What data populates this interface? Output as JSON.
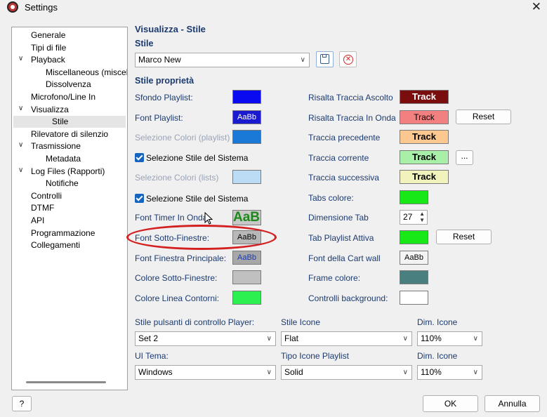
{
  "window": {
    "title": "Settings",
    "close": "✕"
  },
  "tree": {
    "items": [
      {
        "label": "Generale"
      },
      {
        "label": "Tipi di file"
      },
      {
        "label": "Playback",
        "expanded": true
      },
      {
        "label": "Miscellaneous (miscela"
      },
      {
        "label": "Dissolvenza"
      },
      {
        "label": "Microfono/Line In"
      },
      {
        "label": "Visualizza",
        "expanded": true
      },
      {
        "label": "Stile",
        "selected": true
      },
      {
        "label": "Rilevatore di silenzio"
      },
      {
        "label": "Trasmissione",
        "expanded": true
      },
      {
        "label": "Metadata"
      },
      {
        "label": "Log Files (Rapporti)",
        "expanded": true
      },
      {
        "label": "Notifiche"
      },
      {
        "label": "Controlli"
      },
      {
        "label": "DTMF"
      },
      {
        "label": "API"
      },
      {
        "label": "Programmazione"
      },
      {
        "label": "Collegamenti"
      }
    ],
    "caret": "∨"
  },
  "main": {
    "title": "Visualizza - Stile",
    "stile_label": "Stile",
    "stile_value": "Marco New",
    "props_label": "Stile proprietà",
    "left": {
      "sfondo_playlist": "Sfondo Playlist:",
      "font_playlist": "Font Playlist:",
      "font_playlist_sample": "AaBb",
      "selezione_colori_playlist": "Selezione Colori (playlist)",
      "selezione_stile_sistema_1": "Selezione Stile del Sistema",
      "selezione_colori_lists": "Selezione Colori (lists)",
      "selezione_stile_sistema_2": "Selezione Stile del Sistema",
      "font_timer": "Font Timer In Onda",
      "font_timer_sample": "AaBl",
      "font_sotto": "Font Sotto-Finestre:",
      "font_sotto_sample": "AaBb",
      "font_principale": "Font Finestra Principale:",
      "font_principale_sample": "AaBb",
      "colore_sotto": "Colore Sotto-Finestre:",
      "colore_linea": "Colore Linea Contorni:"
    },
    "right": {
      "risalta_ascolto": "Risalta Traccia Ascolto",
      "risalta_onda": "Risalta Traccia In Onda",
      "precedente": "Traccia precedente",
      "corrente": "Traccia corrente",
      "successiva": "Traccia successiva",
      "tabs_colore": "Tabs colore:",
      "dimensione_tab": "Dimensione Tab",
      "dimensione_tab_value": "27",
      "tab_playlist_attiva": "Tab Playlist Attiva",
      "font_cart": "Font della Cart wall",
      "font_cart_sample": "AaBb",
      "frame_colore": "Frame colore:",
      "controlli_bg": "Controlli background:",
      "track_text": "Track",
      "reset": "Reset",
      "ellipsis": "..."
    },
    "bottom": {
      "stile_pulsanti_label": "Stile pulsanti di controllo Player:",
      "stile_pulsanti_value": "Set 2",
      "stile_icone_label": "Stile Icone",
      "stile_icone_value": "Flat",
      "dim_icone_label_1": "Dim. Icone",
      "dim_icone_value_1": "110%",
      "ui_tema_label": "UI Tema:",
      "ui_tema_value": "Windows",
      "tipo_icone_label": "Tipo Icone Playlist",
      "tipo_icone_value": "Solid",
      "dim_icone_label_2": "Dim. Icone",
      "dim_icone_value_2": "110%"
    }
  },
  "footer": {
    "help": "?",
    "ok": "OK",
    "cancel": "Annulla"
  },
  "colors": {
    "sfondo_playlist": "#0a0af0",
    "font_playlist_bg": "#1a1ad0",
    "selezione_playlist": "#1a78d6",
    "selezione_lists": "#bcdcf6",
    "font_timer_bg": "#c8c8c8",
    "font_timer_text": "#1b8a1b",
    "font_sotto_bg": "#b8b8b8",
    "font_principale_bg": "#a7a7a7",
    "colore_sotto": "#c0c0c0",
    "colore_linea": "#2af050",
    "risalta_ascolto_bg": "#7a0e0e",
    "risalta_onda_bg": "#f28080",
    "precedente_bg": "#fdc890",
    "corrente_bg": "#a8f0a8",
    "successiva_bg": "#f2f2bc",
    "tabs_colore": "#18e818",
    "tab_playlist_attiva": "#18e818",
    "frame_colore": "#4a7f80",
    "controlli_bg": "#ffffff",
    "highlight_ellipse": "#d32020"
  }
}
